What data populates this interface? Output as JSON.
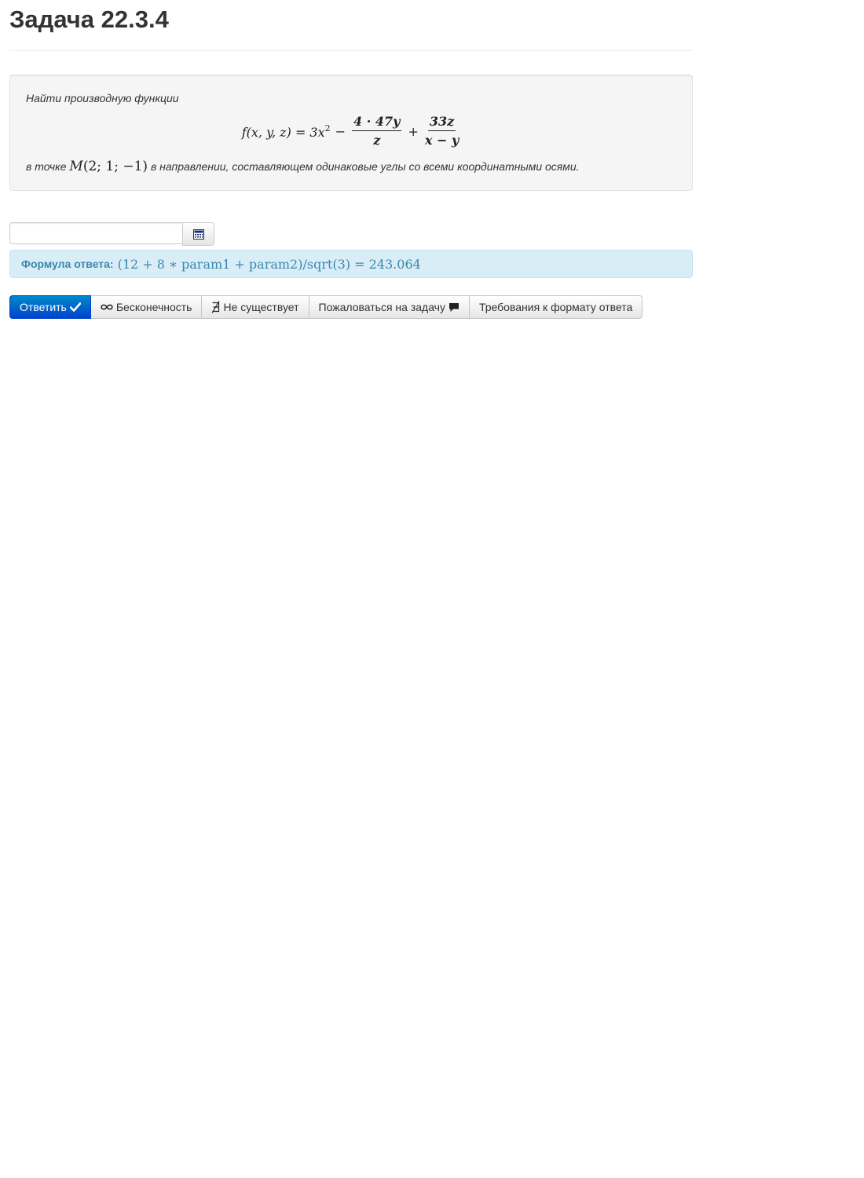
{
  "page": {
    "title": "Задача 22.3.4"
  },
  "problem": {
    "intro": "Найти производную функции",
    "formula": {
      "lhs": "f(x, y, z) = 3x",
      "exp": "2",
      "minus": "−",
      "frac1_num": "4 · 47y",
      "frac1_den": "z",
      "plus": "+",
      "frac2_num": "33z",
      "frac2_den": "x − y"
    },
    "point_prefix": "в точке",
    "point_name": "M",
    "point_coords": "(2; 1; −1)",
    "point_suffix": "в направлении, составляющем одинаковые углы со всеми координатными осями."
  },
  "answer": {
    "input_value": "",
    "input_placeholder": "",
    "calculator_icon": "calculator-icon"
  },
  "formula_alert": {
    "label": "Формула ответа:",
    "expression": "(12 + 8 ∗ param1 + param2)/sqrt(3) = 243.064"
  },
  "buttons": {
    "submit": "Ответить",
    "infinity": "Бесконечность",
    "not_exists": "Не существует",
    "report": "Пожаловаться на задачу",
    "requirements": "Требования к формату ответа"
  },
  "colors": {
    "primary": "#0055cc",
    "alert_bg": "#d9edf7",
    "alert_text": "#3a87ad",
    "well_bg": "#f5f5f5"
  }
}
